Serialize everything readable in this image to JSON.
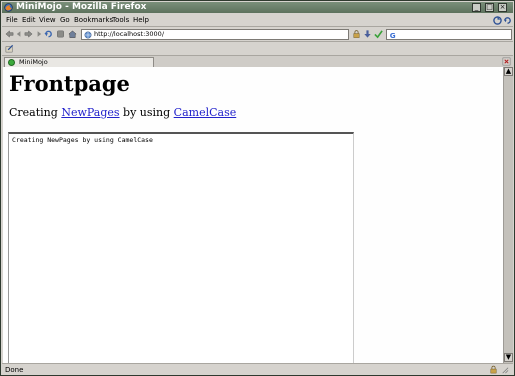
{
  "window": {
    "title": "MiniMojo - Mozilla Firefox"
  },
  "menu": [
    "File",
    "Edit",
    "View",
    "Go",
    "Bookmarks",
    "Tools",
    "Help"
  ],
  "navigation": {
    "url": "http://localhost:3000/",
    "search_value": ""
  },
  "tab": {
    "label": "MiniMojo"
  },
  "page": {
    "title": "Frontpage",
    "intro_prefix": "Creating",
    "link1": "NewPages",
    "intro_middle": "by using",
    "link2": "CamelCase",
    "editor_text": "Creating NewPages by using CamelCase"
  },
  "status": {
    "text": "Done"
  },
  "icons": {
    "back": "back-arrow-icon",
    "forward": "forward-arrow-icon",
    "reload": "reload-icon",
    "stop": "stop-icon",
    "home": "home-icon",
    "go": "go-arrow-icon",
    "search_engine": "google-icon",
    "security": "padlock-icon"
  },
  "colors": {
    "link": "#2222cc",
    "titlebar": "#6b806b",
    "chrome": "#d6d3ce"
  }
}
